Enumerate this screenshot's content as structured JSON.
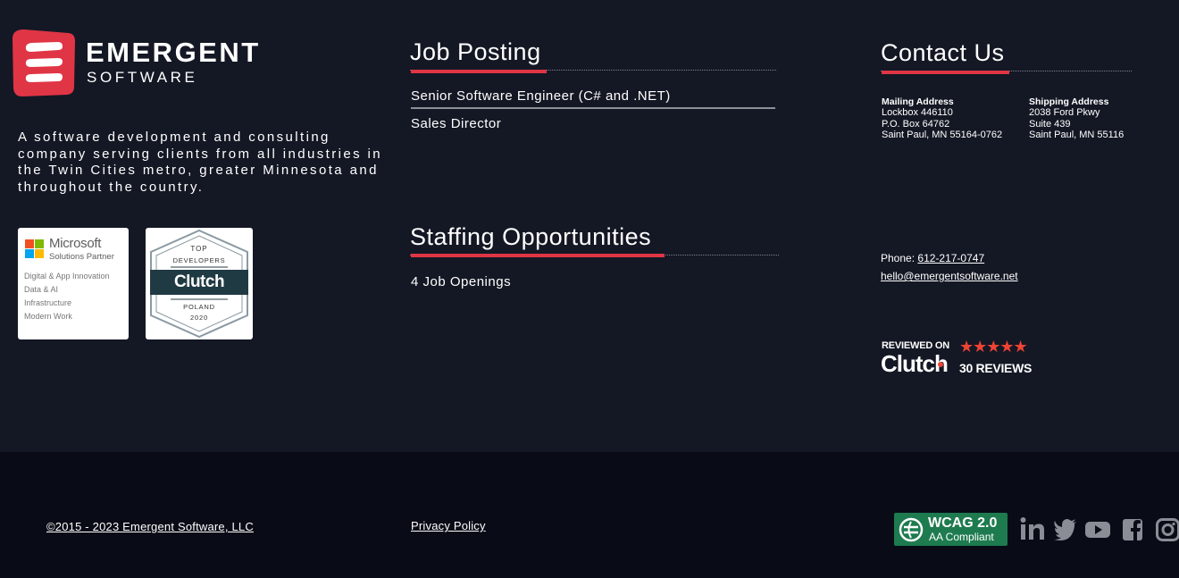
{
  "brand": {
    "name": "EMERGENT",
    "sub": "SOFTWARE",
    "tagline": "A software development and consulting company serving clients from all industries in the Twin Cities metro, greater Minnesota and throughout the country."
  },
  "badges": {
    "microsoft": {
      "name": "Microsoft",
      "subtitle": "Solutions Partner",
      "items": [
        "Digital & App Innovation",
        "Data & AI",
        "Infrastructure",
        "Modern Work"
      ]
    },
    "clutch": {
      "top": "TOP",
      "developers": "DEVELOPERS",
      "brand": "Clutch",
      "country": "POLAND",
      "year": "2020"
    }
  },
  "jobs": {
    "heading": "Job Posting",
    "items": [
      "Senior Software Engineer (C# and .NET)",
      "Sales Director"
    ]
  },
  "staffing": {
    "heading": "Staffing Opportunities",
    "link": "4 Job Openings"
  },
  "contact": {
    "heading": "Contact Us",
    "mailing": {
      "title": "Mailing Address",
      "lines": [
        "Lockbox 446110",
        "P.O. Box 64762",
        "Saint Paul, MN 55164-0762"
      ]
    },
    "shipping": {
      "title": "Shipping Address",
      "lines": [
        "2038 Ford Pkwy",
        "Suite 439",
        "Saint Paul, MN 55116"
      ]
    },
    "phone_label": "Phone:",
    "phone": "612-217-0747",
    "email": "hello@emergentsoftware.net"
  },
  "review": {
    "reviewed_on": "REVIEWED ON",
    "brand": "Clutch",
    "stars": "★★★★★",
    "count": "30 REVIEWS"
  },
  "footer": {
    "copyright": "©2015 - 2023 Emergent Software, LLC",
    "privacy": "Privacy Policy",
    "wcag_title": "WCAG 2.0",
    "wcag_sub": "AA Compliant",
    "social": [
      "linkedin-icon",
      "twitter-icon",
      "youtube-icon",
      "facebook-icon",
      "instagram-icon"
    ]
  },
  "colors": {
    "background": "#141824",
    "footer_background": "#090c17",
    "accent_red": "#e03545",
    "wcag_green": "#1e7b4f",
    "social_gray": "#8a8d95"
  }
}
